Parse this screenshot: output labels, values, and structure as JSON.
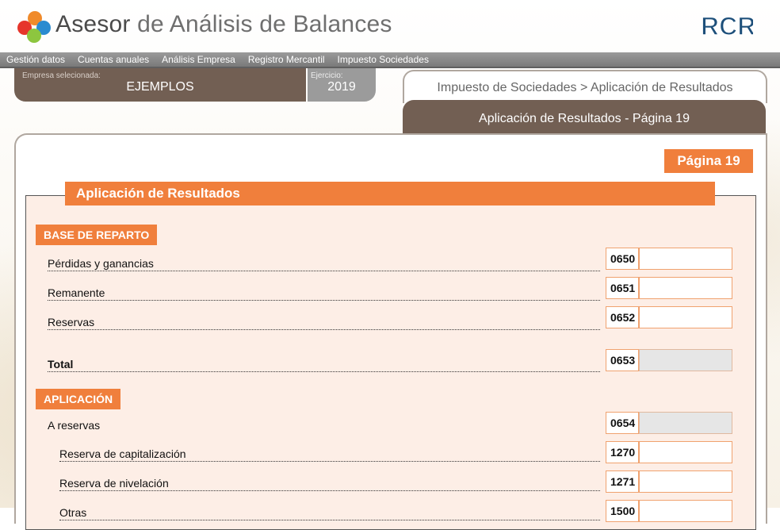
{
  "app": {
    "title_part1": "Asesor",
    "title_part2": "de Análisis de Balances",
    "brand": "RCR"
  },
  "menu": [
    "Gestión datos",
    "Cuentas anuales",
    "Análisis Empresa",
    "Registro Mercantil",
    "Impuesto Sociedades"
  ],
  "company": {
    "label": "Empresa selecionada:",
    "value": "EJEMPLOS"
  },
  "year": {
    "label": "Ejercicio:",
    "value": "2019"
  },
  "breadcrumb": "Impuesto de Sociedades > Aplicación de Resultados",
  "subtab": "Aplicación de Resultados - Página 19",
  "page_badge": "Página 19",
  "form_title": "Aplicación de Resultados",
  "sections": {
    "base": "BASE DE REPARTO",
    "aplicacion": "APLICACIÓN"
  },
  "rows": [
    {
      "label": "Pérdidas y ganancias",
      "code": "0650",
      "value": ""
    },
    {
      "label": "Remanente",
      "code": "0651",
      "value": ""
    },
    {
      "label": "Reservas",
      "code": "0652",
      "value": ""
    },
    {
      "label": "Total",
      "code": "0653",
      "value": ""
    },
    {
      "label": "A reservas",
      "code": "0654",
      "value": ""
    },
    {
      "label": "Reserva de capitalización",
      "code": "1270",
      "value": ""
    },
    {
      "label": "Reserva de nivelación",
      "code": "1271",
      "value": ""
    },
    {
      "label": "Otras",
      "code": "1500",
      "value": ""
    }
  ]
}
